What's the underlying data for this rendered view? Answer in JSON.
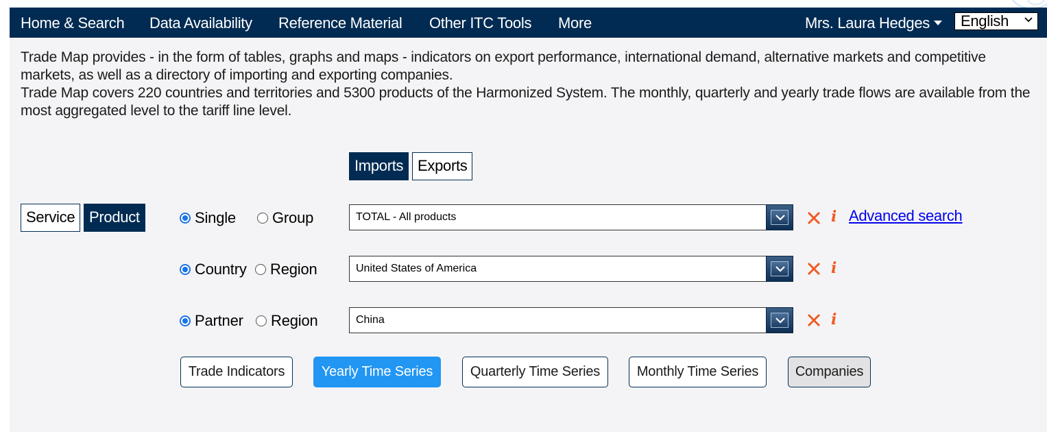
{
  "nav": {
    "items": [
      "Home & Search",
      "Data Availability",
      "Reference Material",
      "Other ITC Tools",
      "More"
    ],
    "user": "Mrs. Laura Hedges",
    "language": "English"
  },
  "intro": {
    "line1": "Trade Map provides - in the form of tables, graphs and maps - indicators on export performance, international demand, alternative markets and competitive markets, as well as a directory of importing and exporting companies.",
    "line2": "Trade Map covers 220 countries and territories and 5300 products of the Harmonized System. The monthly, quarterly and yearly trade flows are available from the most aggregated level to the tariff line level."
  },
  "flow": {
    "imports": "Imports",
    "exports": "Exports",
    "selected": "Imports"
  },
  "mode": {
    "service": "Service",
    "product": "Product",
    "selected": "Product"
  },
  "product_row": {
    "opt1": "Single",
    "opt2": "Group",
    "selected": "Single",
    "value": "TOTAL - All products",
    "advanced_link": "Advanced search"
  },
  "country_row": {
    "opt1": "Country",
    "opt2": "Region",
    "selected": "Country",
    "value": "United States of America"
  },
  "partner_row": {
    "opt1": "Partner",
    "opt2": "Region",
    "selected": "Partner",
    "value": "China"
  },
  "info_glyph": "i",
  "actions": {
    "trade_indicators": "Trade Indicators",
    "yearly": "Yearly Time Series",
    "quarterly": "Quarterly Time Series",
    "monthly": "Monthly Time Series",
    "companies": "Companies",
    "active": "Yearly Time Series"
  },
  "colors": {
    "navy": "#012b52",
    "accent_blue": "#2196f3",
    "clear_orange": "#f05a22",
    "link": "#0000ee"
  }
}
